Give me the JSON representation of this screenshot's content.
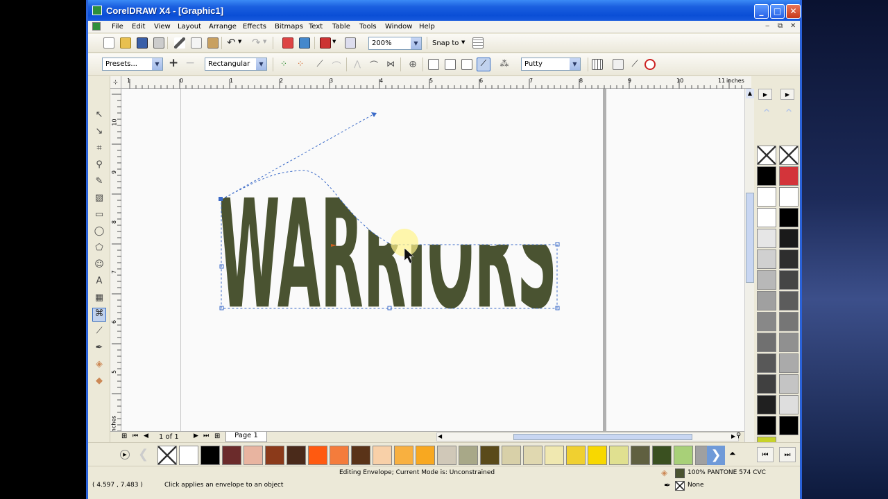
{
  "window": {
    "title": "CorelDRAW X4 - [Graphic1]",
    "btn_min": "_",
    "btn_max": "□",
    "btn_close": "✕"
  },
  "menu": [
    "File",
    "Edit",
    "View",
    "Layout",
    "Arrange",
    "Effects",
    "Bitmaps",
    "Text",
    "Table",
    "Tools",
    "Window",
    "Help"
  ],
  "mdi_controls": [
    "‒",
    "⧉",
    "✕"
  ],
  "toolbar": {
    "zoom": "200%",
    "snap_to": "Snap to",
    "presets": "Presets...",
    "shape_mode": "Rectangular",
    "mapping_mode": "Putty"
  },
  "ruler": {
    "unit": "inches",
    "h_ticks": [
      "1",
      "0",
      "1",
      "2",
      "3",
      "4",
      "5",
      "6",
      "7",
      "8",
      "9",
      "10",
      "11"
    ],
    "v_ticks": [
      "10",
      "9",
      "8",
      "7",
      "6",
      "5"
    ],
    "v_unit": "inches"
  },
  "artwork": {
    "text": "WARRIORS",
    "fill_color": "#4a5331"
  },
  "page_nav": {
    "count": "1 of 1",
    "tab": "Page 1"
  },
  "status": {
    "coords": "( 4.597 , 7.483 )",
    "hint": "Click applies an envelope to an object",
    "mode": "Editing Envelope;  Current Mode is: Unconstrained",
    "fill": "100% PANTONE 574 CVC",
    "outline": "None",
    "fill_swatch": "#4a5331"
  },
  "palette_vertical": {
    "col1": [
      "none",
      "#000000",
      "#ffffff",
      "#ffffff",
      "#e6e6e6",
      "#d0d0d0",
      "#b8b8b8",
      "#a0a0a0",
      "#888888",
      "#707070",
      "#585858",
      "#404040",
      "#202020",
      "#000000",
      "#c7d22a"
    ],
    "col2": [
      "none",
      "#d3343a",
      "#ffffff",
      "#000000",
      "#1a1a1a",
      "#2e2e2e",
      "#454545",
      "#5c5c5c",
      "#767676",
      "#909090",
      "#aaaaaa",
      "#c4c4c4",
      "#dedede",
      "#000000"
    ]
  },
  "palette_horizontal": [
    "none",
    "#ffffff",
    "#000000",
    "#6b2b2b",
    "#e8b4a0",
    "#8b3a1a",
    "#4a2a1a",
    "#ff5a10",
    "#f47c3c",
    "#5a3318",
    "#f8d0a8",
    "#f8b040",
    "#f8a820",
    "#d0c8b8",
    "#a8a888",
    "#5a4a1a",
    "#d8d0a8",
    "#e0d8b0",
    "#f0e8b0",
    "#f0d030",
    "#f8d800",
    "#e0e090",
    "#606040",
    "#3a5020",
    "#a8d078",
    "#a0a0a0"
  ]
}
